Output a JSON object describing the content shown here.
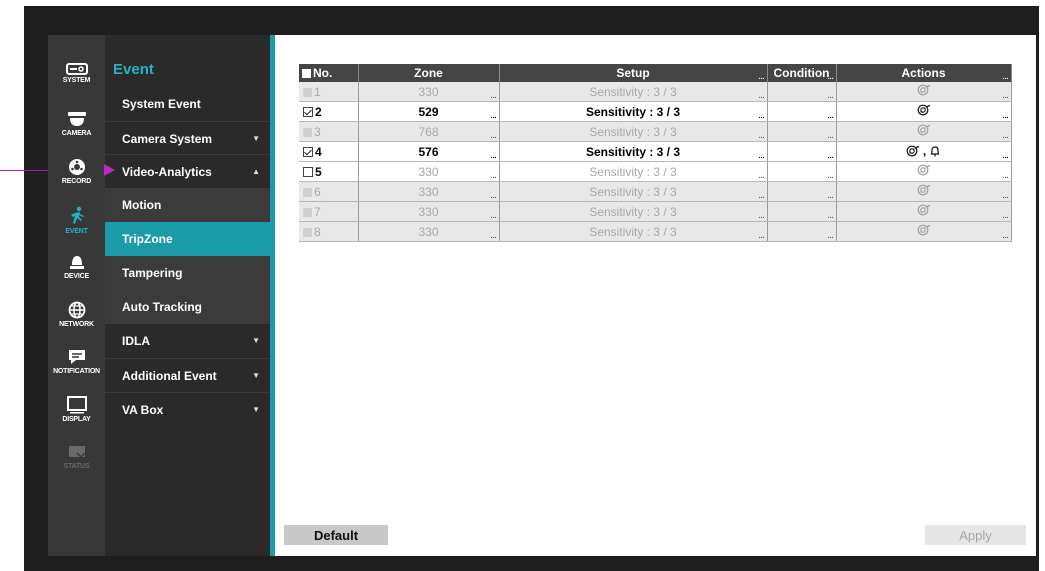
{
  "nav_rail": [
    {
      "label": "SYSTEM",
      "icon": "system-toggle-icon",
      "state": "normal"
    },
    {
      "label": "CAMERA",
      "icon": "camera-dome-icon",
      "state": "normal"
    },
    {
      "label": "RECORD",
      "icon": "record-icon",
      "state": "normal"
    },
    {
      "label": "EVENT",
      "icon": "running-person-icon",
      "state": "active"
    },
    {
      "label": "DEVICE",
      "icon": "device-icon",
      "state": "normal"
    },
    {
      "label": "NETWORK",
      "icon": "globe-icon",
      "state": "normal"
    },
    {
      "label": "NOTIFICATION",
      "icon": "chat-bubble-icon",
      "state": "normal"
    },
    {
      "label": "DISPLAY",
      "icon": "monitor-icon",
      "state": "normal"
    },
    {
      "label": "STATUS",
      "icon": "status-icon",
      "state": "disabled"
    }
  ],
  "submenu": {
    "title": "Event",
    "items": [
      {
        "label": "System Event"
      },
      {
        "label": "Camera System",
        "caret": "▼"
      },
      {
        "label": "Video-Analytics",
        "caret": "▲"
      },
      {
        "label": "Motion"
      },
      {
        "label": "TripZone"
      },
      {
        "label": "Tampering"
      },
      {
        "label": "Auto Tracking"
      },
      {
        "label": "IDLA",
        "caret": "▼"
      },
      {
        "label": "Additional Event",
        "caret": "▼"
      },
      {
        "label": "VA Box",
        "caret": "▼"
      }
    ]
  },
  "table": {
    "headers": {
      "no": "No.",
      "zone": "Zone",
      "setup": "Setup",
      "condition": "Condition",
      "actions": "Actions"
    },
    "rows": [
      {
        "no": "1",
        "zone": "330",
        "setup": "Sensitivity : 3 / 3",
        "state": "disabled",
        "actions": "alarm-out"
      },
      {
        "no": "2",
        "zone": "529",
        "setup": "Sensitivity : 3 / 3",
        "state": "checked",
        "actions": "alarm-out"
      },
      {
        "no": "3",
        "zone": "768",
        "setup": "Sensitivity : 3 / 3",
        "state": "disabled",
        "actions": "alarm-out"
      },
      {
        "no": "4",
        "zone": "576",
        "setup": "Sensitivity : 3 / 3",
        "state": "checked",
        "actions": "alarm-out,buzzer"
      },
      {
        "no": "5",
        "zone": "330",
        "setup": "Sensitivity : 3 / 3",
        "state": "unchecked",
        "actions": "alarm-out"
      },
      {
        "no": "6",
        "zone": "330",
        "setup": "Sensitivity : 3 / 3",
        "state": "disabled",
        "actions": "alarm-out"
      },
      {
        "no": "7",
        "zone": "330",
        "setup": "Sensitivity : 3 / 3",
        "state": "disabled",
        "actions": "alarm-out"
      },
      {
        "no": "8",
        "zone": "330",
        "setup": "Sensitivity : 3 / 3",
        "state": "disabled",
        "actions": "alarm-out"
      }
    ]
  },
  "buttons": {
    "default": "Default",
    "apply": "Apply"
  },
  "colors": {
    "accent": "#1b9aa8",
    "annotation_arrow": "#b829c8"
  }
}
